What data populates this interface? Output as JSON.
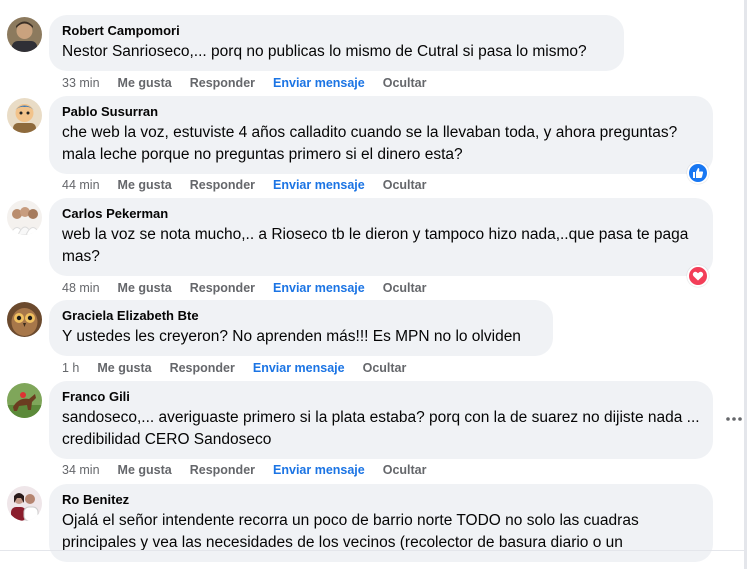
{
  "comments": [
    {
      "author": "Robert Campomori",
      "text": "Nestor Sanrioseco,... porq no publicas lo mismo de Cutral si pasa lo mismo?",
      "time": "33 min",
      "avatar_icon": "avatar-photo-man"
    },
    {
      "author": "Pablo Susurran",
      "text": "che web la voz, estuviste 4 años calladito cuando se la llevaban toda, y ahora preguntas? mala leche porque no preguntas primero si el dinero esta?",
      "time": "44 min",
      "avatar_icon": "avatar-photo-cartoon",
      "reaction": "like-reaction-icon"
    },
    {
      "author": "Carlos Pekerman",
      "text": "web la voz se nota mucho,.. a Rioseco tb le dieron y tampoco hizo nada,..que pasa te paga mas?",
      "time": "48 min",
      "avatar_icon": "avatar-photo-group",
      "reaction": "love-reaction-icon"
    },
    {
      "author": "Graciela Elizabeth Bte",
      "text": "Y ustedes les creyeron? No aprenden más!!! Es MPN no lo olviden",
      "time": "1 h",
      "avatar_icon": "avatar-photo-owl"
    },
    {
      "author": "Franco Gili",
      "text": "sandoseco,... averiguaste primero si la plata estaba? porq con la de suarez no dijiste nada ... credibilidad CERO Sandoseco",
      "time": "34 min",
      "avatar_icon": "avatar-photo-horse"
    },
    {
      "author": "Ro Benitez",
      "text": "Ojalá el señor intendente recorra un poco de barrio norte TODO no solo las cuadras principales y vea las necesidades de los vecinos (recolector de basura diario o un",
      "time": "",
      "avatar_icon": "avatar-photo-couple"
    }
  ],
  "actions": {
    "like": "Me gusta",
    "reply": "Responder",
    "message": "Enviar mensaje",
    "hide": "Ocultar"
  },
  "colors": {
    "bubble": "#f0f2f5",
    "secondary_text": "#65676b",
    "message_link": "#1b74e4",
    "like": "#1877f2",
    "love": "#f33e58"
  }
}
